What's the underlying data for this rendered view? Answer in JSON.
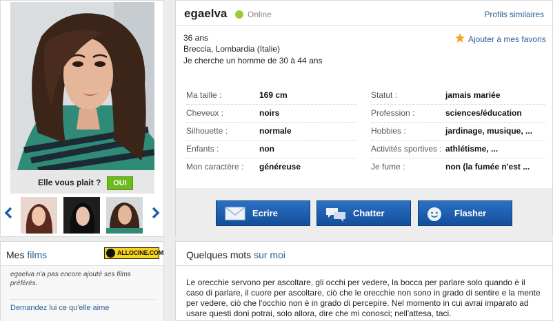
{
  "profile": {
    "username": "egaelva",
    "status": "Online",
    "similar_link": "Profils similaires",
    "age": "36 ans",
    "location": "Breccia, Lombardia (Italie)",
    "seeking": "Je cherche un homme de 30 à 44 ans",
    "favorite_link": "Ajouter à mes favoris"
  },
  "photo": {
    "like_question": "Elle vous plait ?",
    "like_button": "OUI"
  },
  "attributes_left": [
    {
      "label": "Ma taille :",
      "value": "169 cm"
    },
    {
      "label": "Cheveux :",
      "value": "noirs"
    },
    {
      "label": "Silhouette :",
      "value": "normale"
    },
    {
      "label": "Enfants :",
      "value": "non"
    },
    {
      "label": "Mon caractère :",
      "value": "généreuse"
    }
  ],
  "attributes_right": [
    {
      "label": "Statut :",
      "value": "jamais mariée"
    },
    {
      "label": "Profession :",
      "value": "sciences/éducation"
    },
    {
      "label": "Hobbies :",
      "value": "jardinage, musique, ..."
    },
    {
      "label": "Activités sportives :",
      "value": "athlétisme, ..."
    },
    {
      "label": "Je fume :",
      "value": "non (la fumée n'est ..."
    }
  ],
  "actions": {
    "ecrire": "Ecrire",
    "chatter": "Chatter",
    "flasher": "Flasher"
  },
  "films": {
    "title_prefix": "Mes ",
    "title_highlight": "films",
    "allocine": "ALLOCINE.COM",
    "empty_text": "egaelva n'a pas encore ajouté ses films préférés.",
    "ask_link": "Demandez lui ce qu'elle aime"
  },
  "about": {
    "title_prefix": "Quelques mots ",
    "title_highlight": "sur moi",
    "text": "Le orecchie servono per ascoltare, gli occhi per vedere, la bocca per parlare solo quando è il caso di parlare, il cuore per ascoltare, ciò che le orecchie non sono in grado di sentire e la mente per vedere, ciò che l'occhio non è in grado di percepire. Nel momento in cui avrai imparato ad usare questi doni potrai, solo allora, dire che mi conosci; nell'attesa, taci."
  },
  "colors": {
    "link": "#2a5f93",
    "online": "#9acd32",
    "like_button": "#6cba1e",
    "action_button": "#1d5fae"
  }
}
